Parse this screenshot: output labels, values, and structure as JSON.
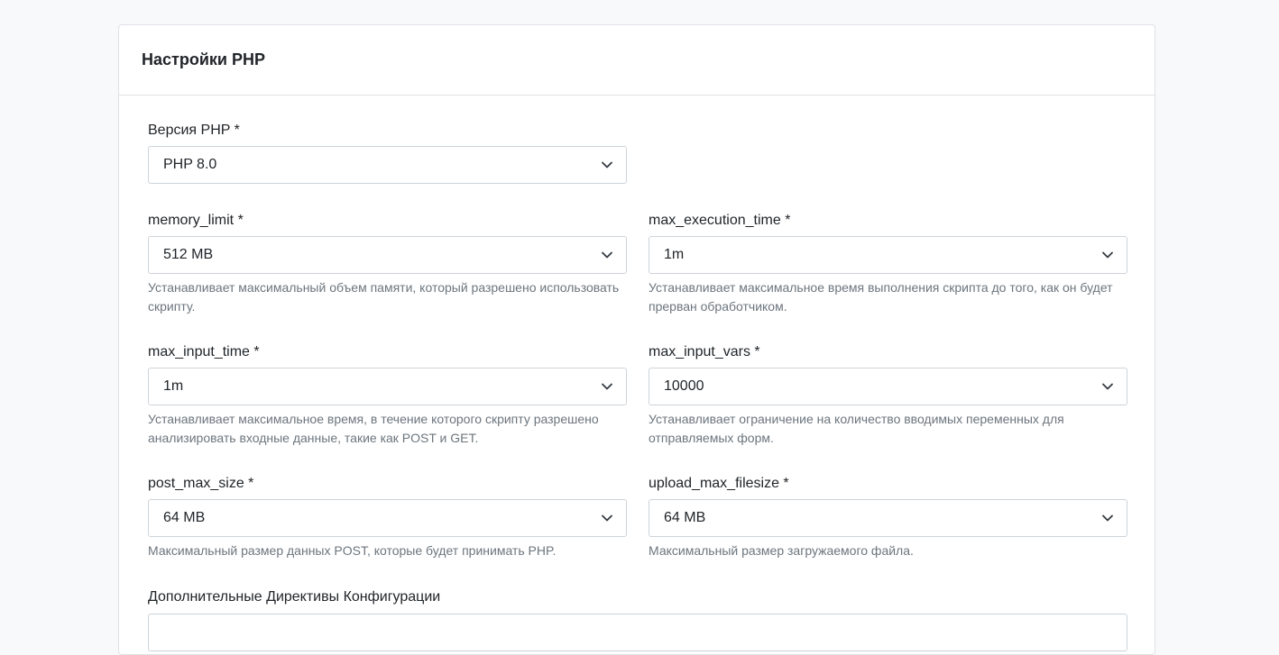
{
  "card": {
    "title": "Настройки PHP"
  },
  "php_version": {
    "label": "Версия PHP *",
    "value": "PHP 8.0"
  },
  "memory_limit": {
    "label": "memory_limit *",
    "value": "512 MB",
    "help": "Устанавливает максимальный объем памяти, который разрешено использовать скрипту."
  },
  "max_execution_time": {
    "label": "max_execution_time *",
    "value": "1m",
    "help": "Устанавливает максимальное время выполнения скрипта до того, как он будет прерван обработчиком."
  },
  "max_input_time": {
    "label": "max_input_time *",
    "value": "1m",
    "help": "Устанавливает максимальное время, в течение которого скрипту разрешено анализировать входные данные, такие как POST и GET."
  },
  "max_input_vars": {
    "label": "max_input_vars *",
    "value": "10000",
    "help": "Устанавливает ограничение на количество вводимых переменных для отправляемых форм."
  },
  "post_max_size": {
    "label": "post_max_size *",
    "value": "64 MB",
    "help": "Максимальный размер данных POST, которые будет принимать PHP."
  },
  "upload_max_filesize": {
    "label": "upload_max_filesize *",
    "value": "64 MB",
    "help": "Максимальный размер загружаемого файла."
  },
  "extra_directives": {
    "label": "Дополнительные Директивы Конфигурации"
  },
  "icons": {
    "select_caret": "chevron-down-icon"
  },
  "colors": {
    "border": "#dfe2e6",
    "help_text": "#6c757d",
    "background": "#f8f9fb"
  }
}
